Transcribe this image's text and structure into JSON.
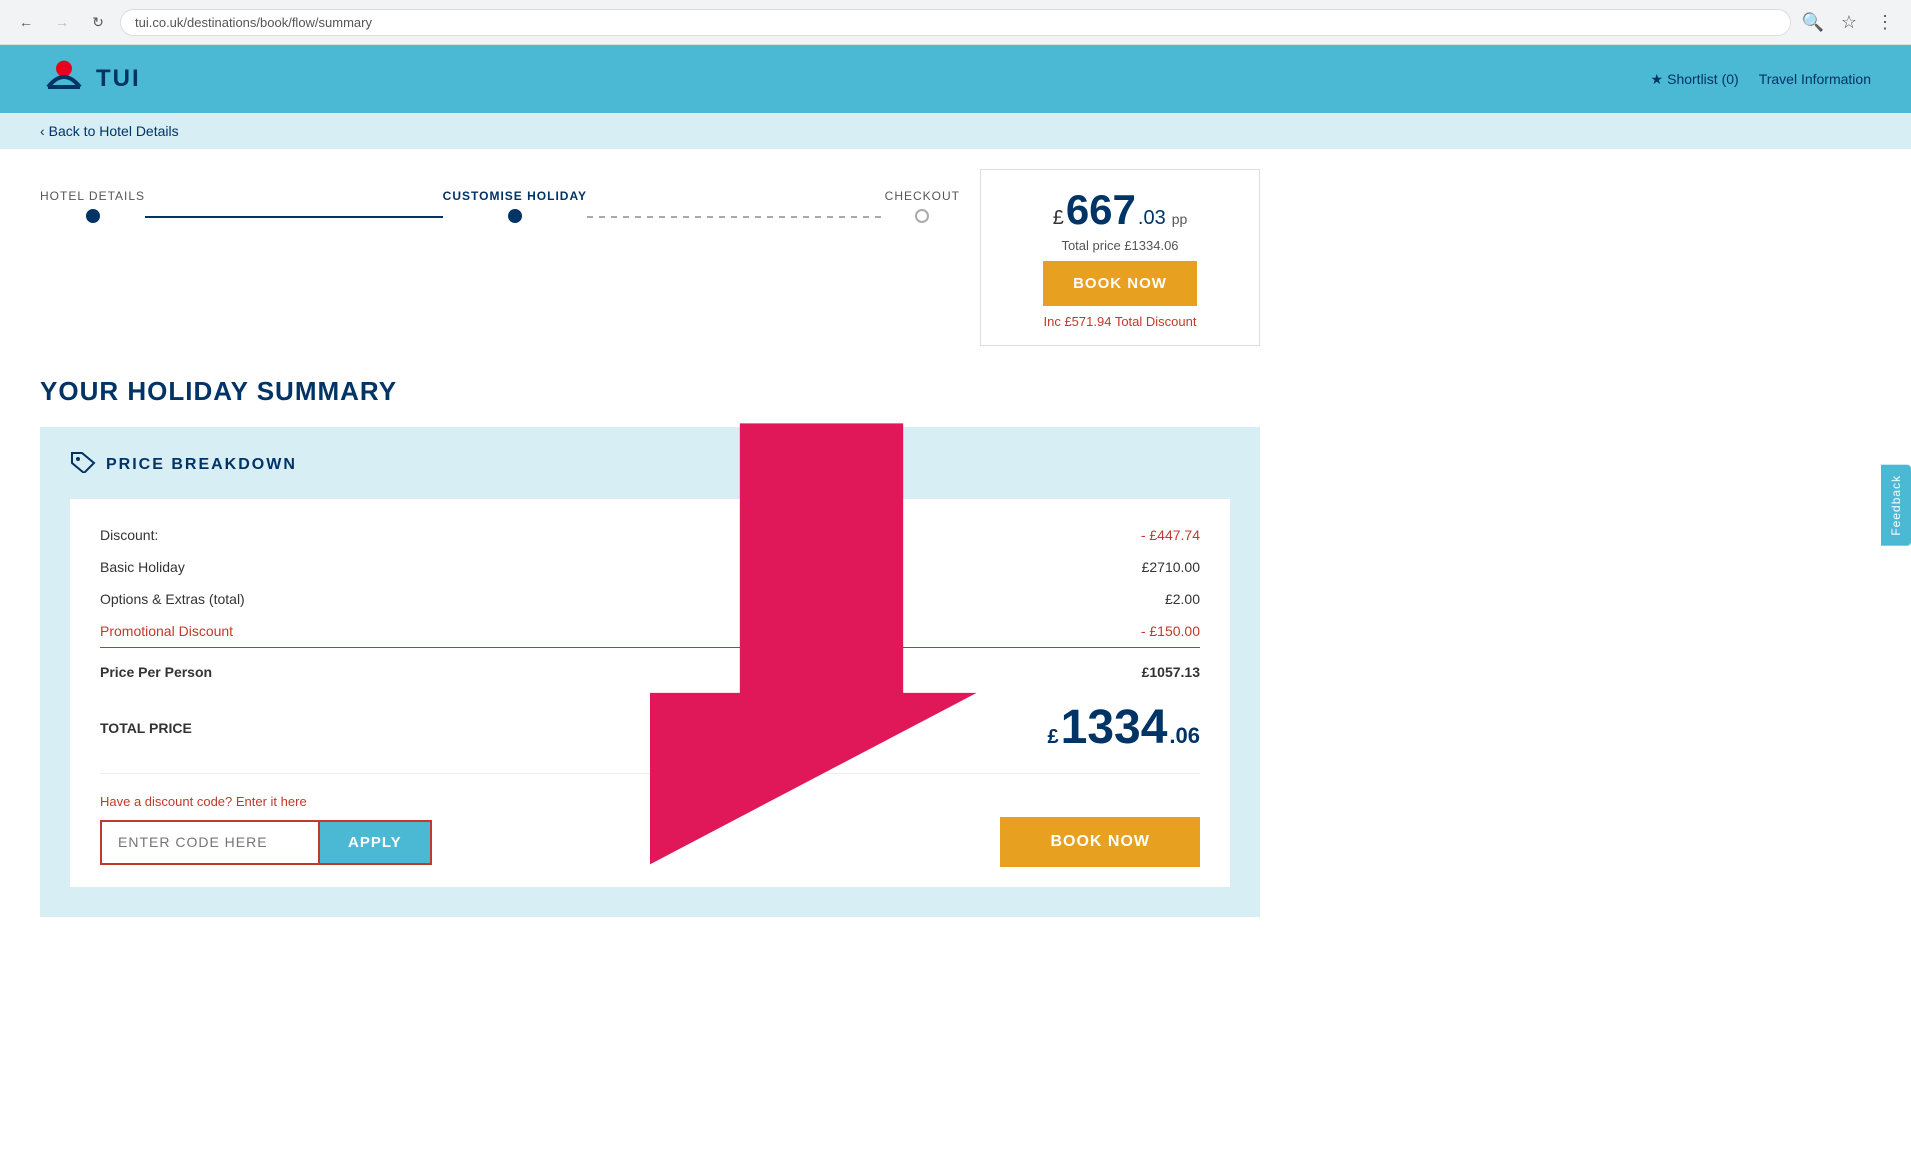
{
  "browser": {
    "url": "tui.co.uk/destinations/book/flow/summary",
    "back_disabled": false,
    "forward_disabled": false
  },
  "header": {
    "logo_text": "TUI",
    "shortlist_label": "Shortlist (0)",
    "travel_info_label": "Travel Information"
  },
  "sub_header": {
    "back_label": "Back to Hotel Details"
  },
  "progress": {
    "steps": [
      {
        "label": "HOTEL DETAILS",
        "state": "completed"
      },
      {
        "label": "CUSTOMISE HOLIDAY",
        "state": "active"
      },
      {
        "label": "CHECKOUT",
        "state": "pending"
      }
    ]
  },
  "booking_widget": {
    "price_pound": "£",
    "price_main": "667",
    "price_decimal": ".03",
    "price_pp": "pp",
    "total_label": "Total price £1334.06",
    "book_now_label": "BOOK NOW",
    "discount_label": "Inc £571.94 Total Discount"
  },
  "page_title": "YOUR HOLIDAY SUMMARY",
  "price_breakdown": {
    "section_title": "PRICE BREAKDOWN",
    "rows": [
      {
        "label": "Discount:",
        "value": "- £447.74",
        "type": "discount"
      },
      {
        "label": "Basic Holiday",
        "value": "£2710.00",
        "type": "normal"
      },
      {
        "label": "Options & Extras (total)",
        "value": "£2.00",
        "type": "normal"
      },
      {
        "label": "Promotional Discount",
        "value": "- £150.00",
        "type": "promo"
      }
    ],
    "per_person_label": "Price Per Person",
    "per_person_value": "£1057.13",
    "total_label": "TOTAL PRICE",
    "total_pound": "£",
    "total_main": "1334",
    "total_decimal": ".06"
  },
  "discount_code": {
    "label": "Have a discount code? Enter it here",
    "placeholder": "ENTER CODE HERE",
    "apply_label": "APPLY"
  },
  "bottom_book_now": "BOOK NOW",
  "feedback_tab": "Feedback"
}
